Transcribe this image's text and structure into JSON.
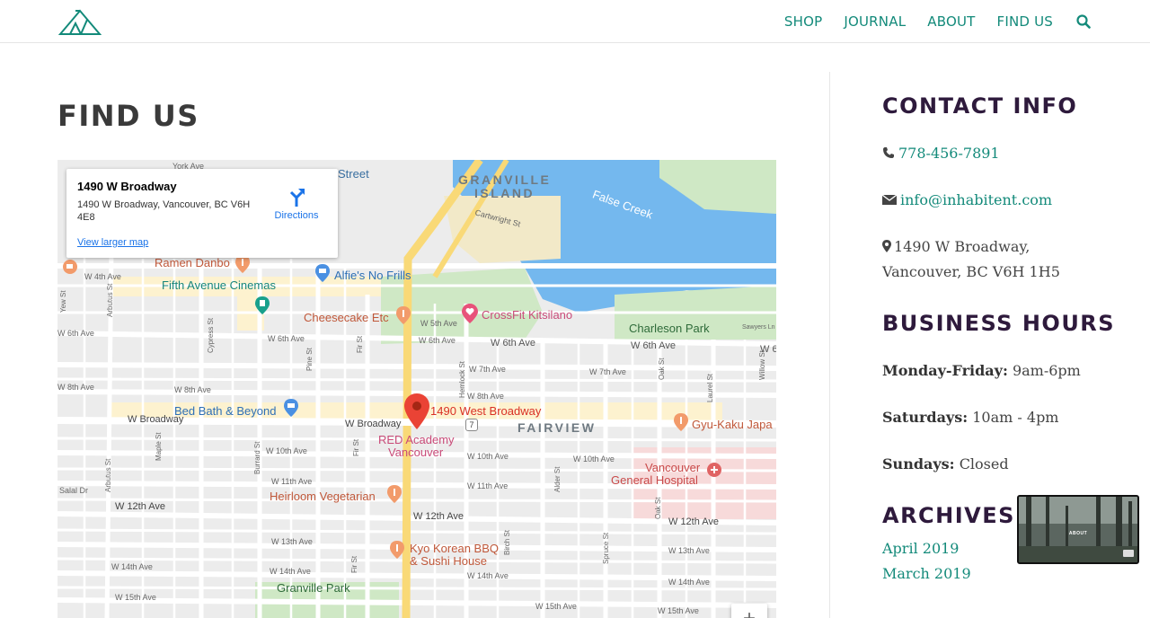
{
  "nav": {
    "items": [
      "SHOP",
      "JOURNAL",
      "ABOUT",
      "FIND US"
    ],
    "search_icon": "search-icon",
    "accent": "#138a7a"
  },
  "main": {
    "title": "FIND US"
  },
  "map": {
    "info_window": {
      "title": "1490 W Broadway",
      "address": "1490 W Broadway, Vancouver, BC V6H 4E8",
      "directions": "Directions",
      "larger_map": "View larger map"
    },
    "zoom_in": "+",
    "labels": {
      "granville_island_1": "GRANVILLE",
      "granville_island_2": "ISLAND",
      "false_creek": "False Creek",
      "fairview": "FAIRVIEW",
      "york_ave": "York Ave",
      "street": "Street",
      "cartwright": "Cartwright St",
      "ramen_danbo": "Ramen Danbo",
      "alfies": "Alfie's No Frills",
      "fifth_ave_cinemas": "Fifth Avenue Cinemas",
      "w4th": "W 4th Ave",
      "cheesecake": "Cheesecake Etc",
      "crossfit": "CrossFit Kitsilano",
      "charleson": "Charleson Park",
      "w5th": "W 5th Ave",
      "w6th_1": "W 6th Ave",
      "w6th_2": "W 6th Ave",
      "w6th_3": "W 6th Ave",
      "w6th_4": "W 6th Ave",
      "w6th_5": "W 6th",
      "w7th_1": "W 7th Ave",
      "w7th_2": "W 7th Ave",
      "w8th_1": "W 8th Ave",
      "w8th_2": "W 8th Ave",
      "w8th_3": "W 8th Ave",
      "bed_bath": "Bed Bath & Beyond",
      "broadway_1": "W Broadway",
      "broadway_2": "W Broadway",
      "pin_label": "1490 West Broadway",
      "red_academy_1": "RED Academy",
      "red_academy_2": "Vancouver",
      "gyu_kaku": "Gyu-Kaku Japa",
      "w10th_1": "W 10th Ave",
      "w10th_2": "W 10th Ave",
      "w10th_3": "W 10th Ave",
      "w11th_1": "W 11th Ave",
      "w11th_2": "W 11th Ave",
      "heirloom": "Heirloom Vegetarian",
      "vgh_1": "Vancouver",
      "vgh_2": "General Hospital",
      "w12th_1": "W 12th Ave",
      "w12th_2": "W 12th Ave",
      "w12th_3": "W 12th Ave",
      "salal": "Salal Dr",
      "w13th_1": "W 13th Ave",
      "w13th_2": "W 13th Ave",
      "kyo_1": "Kyo Korean BBQ",
      "kyo_2": "& Sushi House",
      "w14th_1": "W 14th Ave",
      "w14th_2": "W 14th Ave",
      "w14th_3": "W 14th Ave",
      "granville_park": "Granville Park",
      "w15th_1": "W 15th Ave",
      "w15th_2": "W 15th Ave",
      "w15th_3": "W 15th Ave",
      "sawyers": "Sawyers Ln",
      "hemlock": "Hemlock St",
      "fir": "Fir St",
      "fir_2": "Fir St",
      "burrard": "Burrard St",
      "arbutus": "Arbutus St",
      "arbutus_2": "Arbutus St",
      "cypress": "Cypress St",
      "pine": "Pine St",
      "maple": "Maple St",
      "oak": "Oak St",
      "oak_2": "Oak St",
      "alder": "Alder St",
      "birch": "Birch St",
      "spruce": "Spruce St",
      "laurel": "Laurel St",
      "yew": "Yew St",
      "willow": "Willow St",
      "route7": "7"
    }
  },
  "sidebar": {
    "contact_title": "CONTACT INFO",
    "phone": "778-456-7891",
    "email": "info@inhabitent.com",
    "address_line1": "1490 W Broadway,",
    "address_line2": "Vancouver, BC V6H 1H5",
    "hours_title": "BUSINESS HOURS",
    "hours": [
      {
        "day": "Monday-Friday:",
        "time": "9am-6pm"
      },
      {
        "day": "Saturdays:",
        "time": "10am - 4pm"
      },
      {
        "day": "Sundays:",
        "time": "Closed"
      }
    ],
    "archives_title": "ARCHIVES",
    "archives": [
      "April 2019",
      "March 2019"
    ]
  },
  "video": {
    "label": "ABOUT"
  }
}
